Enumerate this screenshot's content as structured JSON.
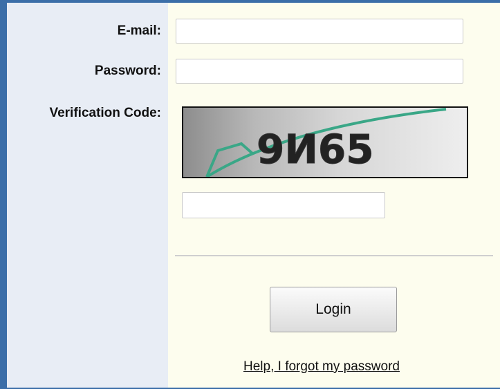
{
  "form": {
    "email_label": "E-mail:",
    "email_value": "",
    "password_label": "Password:",
    "password_value": "",
    "verification_label": "Verification Code:",
    "captcha_text": "9И65",
    "verification_value": "",
    "login_button": "Login",
    "forgot_link": "Help, I forgot my password"
  },
  "colors": {
    "frame": "#3b6ea8",
    "label_panel": "#e8edf5",
    "field_panel": "#fdfdee",
    "captcha_line": "#3aa787"
  }
}
